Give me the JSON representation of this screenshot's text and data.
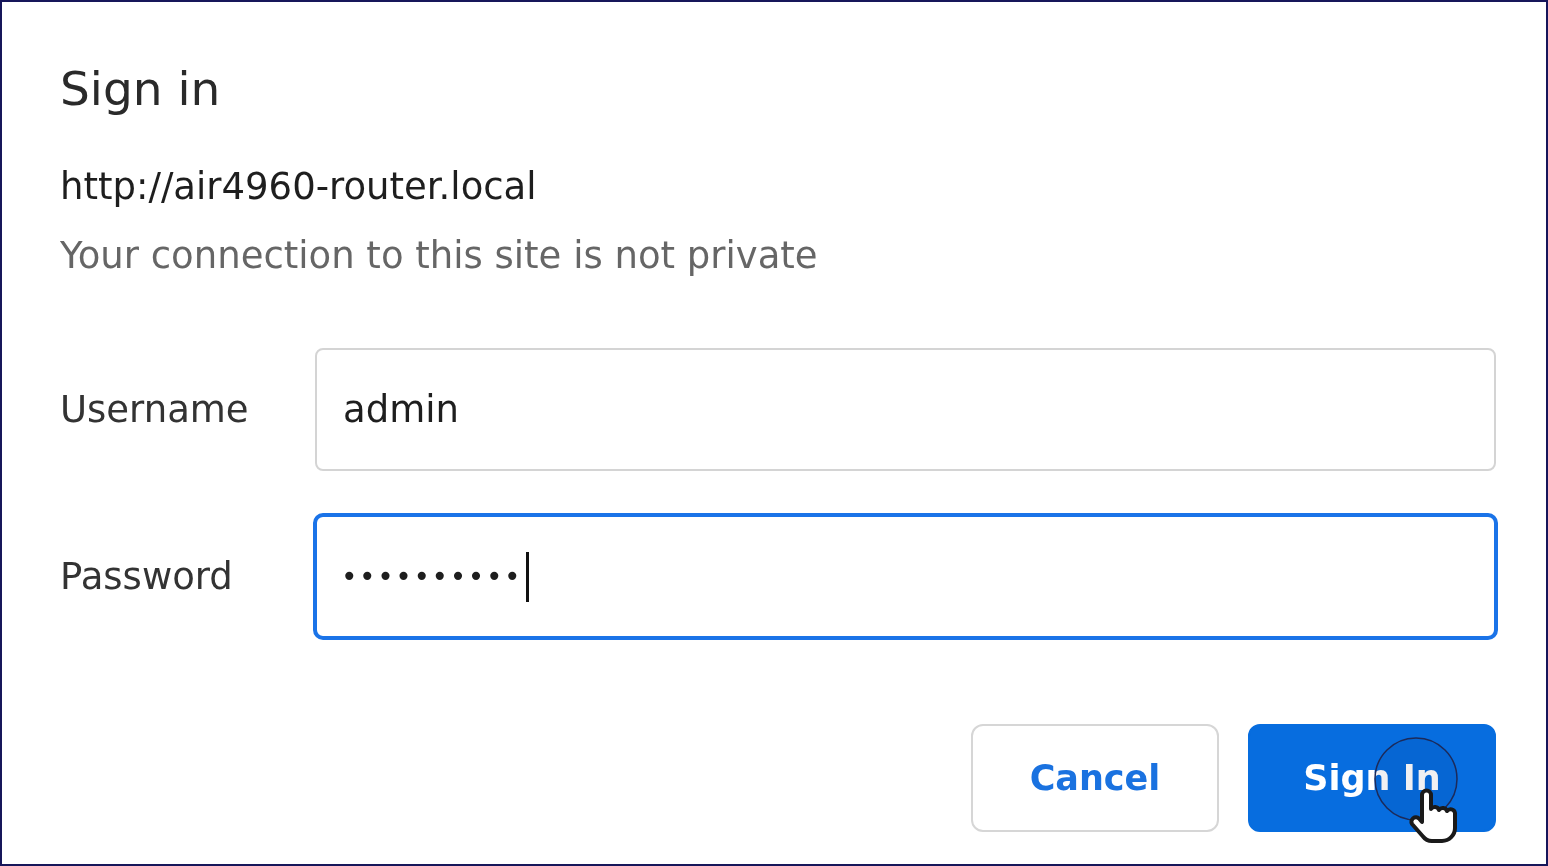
{
  "dialog": {
    "title": "Sign in",
    "site_url": "http://air4960-router.local",
    "security_note": "Your connection to this site is not private"
  },
  "fields": [
    {
      "label": "Username",
      "kind": "text",
      "value": "admin",
      "focused": false
    },
    {
      "label": "Password",
      "kind": "password",
      "value": "••••••••••",
      "focused": true
    }
  ],
  "buttons": [
    {
      "label": "Cancel",
      "kind": "secondary",
      "hovered": false
    },
    {
      "label": "Sign In",
      "kind": "primary",
      "hovered": true
    }
  ]
}
